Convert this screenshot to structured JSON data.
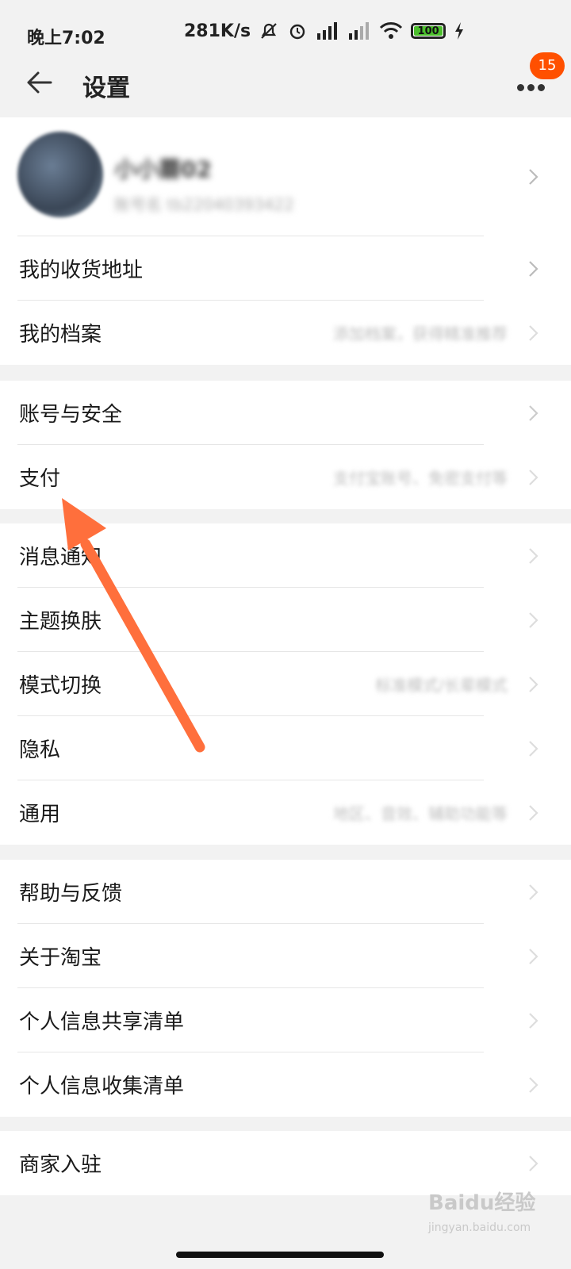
{
  "status_bar": {
    "time": "晚上7:02",
    "speed": "281K/s",
    "battery": "100"
  },
  "header": {
    "title": "设置",
    "badge_count": "15"
  },
  "profile": {
    "name": "小小蘑02",
    "account": "账号名 tb22040393422"
  },
  "groups": [
    {
      "items": [
        {
          "label": "我的收货地址",
          "sub": ""
        },
        {
          "label": "我的档案",
          "sub": "添加档案，获得精准推荐"
        }
      ]
    },
    {
      "items": [
        {
          "label": "账号与安全",
          "sub": ""
        },
        {
          "label": "支付",
          "sub": "支付宝账号、免密支付等"
        }
      ]
    },
    {
      "items": [
        {
          "label": "消息通知",
          "sub": ""
        },
        {
          "label": "主题换肤",
          "sub": ""
        },
        {
          "label": "模式切换",
          "sub": "标准模式/长辈模式"
        },
        {
          "label": "隐私",
          "sub": ""
        },
        {
          "label": "通用",
          "sub": "地区、音效、辅助功能等"
        }
      ]
    },
    {
      "items": [
        {
          "label": "帮助与反馈",
          "sub": ""
        },
        {
          "label": "关于淘宝",
          "sub": ""
        },
        {
          "label": "个人信息共享清单",
          "sub": ""
        },
        {
          "label": "个人信息收集清单",
          "sub": ""
        }
      ]
    },
    {
      "items": [
        {
          "label": "商家入驻",
          "sub": ""
        }
      ]
    }
  ],
  "watermark": {
    "brand": "Baidu经验",
    "url": "jingyan.baidu.com"
  },
  "colors": {
    "accent": "#ff5000",
    "arrow": "#ff6f3c",
    "battery": "#4cbf2d"
  }
}
